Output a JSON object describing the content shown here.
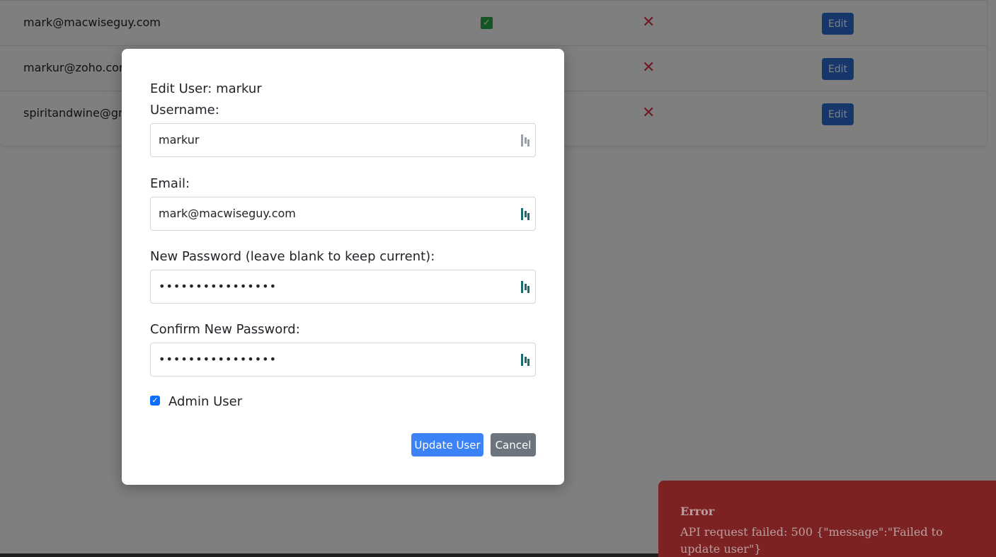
{
  "table": {
    "rows": [
      {
        "email": "mark@macwiseguy.com",
        "edit_label": "Edit"
      },
      {
        "email": "markur@zoho.com",
        "edit_label": "Edit"
      },
      {
        "email": "spiritandwine@gm",
        "edit_label": "Edit"
      }
    ]
  },
  "modal": {
    "title": "Edit User: markur",
    "username_label": "Username:",
    "username_value": "markur",
    "email_label": "Email:",
    "email_value": "mark@macwiseguy.com",
    "new_password_label": "New Password (leave blank to keep current):",
    "new_password_value": "••••••••••••••••",
    "confirm_password_label": "Confirm New Password:",
    "confirm_password_value": "••••••••••••••••",
    "admin_label": "Admin User",
    "update_label": "Update User",
    "cancel_label": "Cancel"
  },
  "toast": {
    "title": "Error",
    "message": "API request failed: 500 {\"message\":\"Failed to update user\"}"
  },
  "icons": {
    "check": "check-icon",
    "x": "x-icon",
    "password_manager": "password-manager-icon"
  },
  "colors": {
    "primary": "#3b82f6",
    "secondary": "#6c757d",
    "danger": "#dc3545",
    "success": "#28a745",
    "toast_bg": "#7c2222"
  }
}
